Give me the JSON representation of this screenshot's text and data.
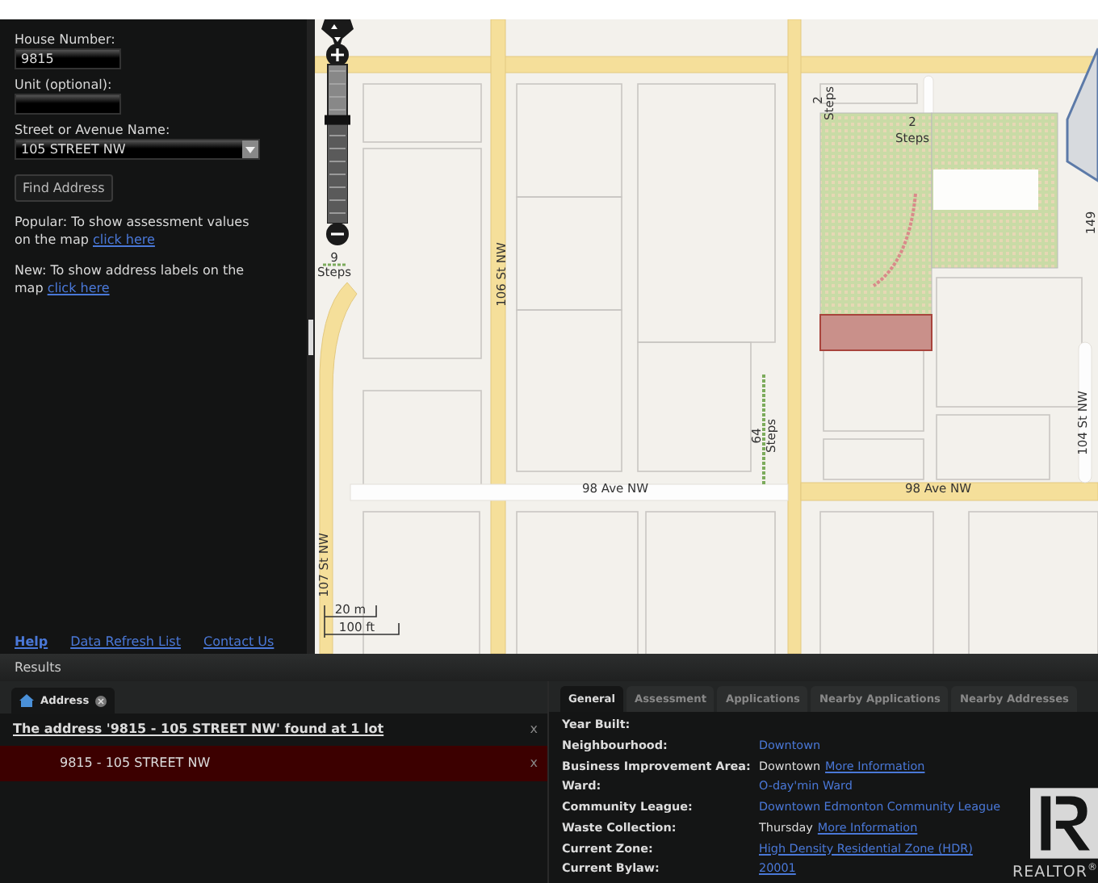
{
  "search_panel": {
    "fields": [
      {
        "label": "House Number:",
        "value": "9815",
        "kind": "text"
      },
      {
        "label": "Unit (optional):",
        "kind": "text"
      },
      {
        "label": "Street or Avenue Name:",
        "value": "105 STREET NW",
        "kind": "select"
      }
    ],
    "find_button": "Find Address",
    "notes": [
      {
        "text": "Popular: To show assessment values on the map",
        "link": "click here"
      },
      {
        "text": "New: To show address labels on the map",
        "link": "click here"
      }
    ],
    "footer_links": [
      {
        "text": "Help",
        "kind": "bold"
      },
      {
        "text": "Data Refresh List",
        "kind": "plain"
      },
      {
        "text": "Contact Us",
        "kind": "plain"
      }
    ]
  },
  "map": {
    "zoom_slider": {
      "level": 0.65
    },
    "labels": [
      {
        "text": "9"
      },
      {
        "text": "Steps"
      },
      {
        "text": "106 St NW"
      },
      {
        "text": "2"
      },
      {
        "text": "Steps"
      },
      {
        "text": "2"
      },
      {
        "text": "Steps"
      },
      {
        "text": "64"
      },
      {
        "text": "Steps"
      },
      {
        "text": "98 Ave NW"
      },
      {
        "text": "98 Ave NW"
      },
      {
        "text": "104 St NW"
      },
      {
        "text": "149"
      },
      {
        "text": "107 St NW"
      },
      {
        "text": "20 m"
      },
      {
        "text": "100 ft"
      }
    ]
  },
  "results": {
    "title": "Results",
    "tabs": [
      {
        "label": "Address",
        "selected": true
      }
    ],
    "heading": "The address '9815 - 105 STREET NW' found at 1 lot",
    "heading_close": "x",
    "items": [
      {
        "text": "9815 - 105 STREET NW",
        "close": "x",
        "selected": true
      }
    ]
  },
  "details": {
    "tabs": [
      {
        "label": "General",
        "selected": true
      },
      {
        "label": "Assessment",
        "selected": false
      },
      {
        "label": "Applications",
        "selected": false
      },
      {
        "label": "Nearby Applications",
        "selected": false
      },
      {
        "label": "Nearby Addresses",
        "selected": false
      }
    ],
    "rows": [
      {
        "label": "Year Built:",
        "parts": []
      },
      {
        "label": "Neighbourhood:",
        "parts": [
          {
            "text": "Downtown",
            "kind": "link"
          }
        ]
      },
      {
        "label": "Business Improvement Area:",
        "parts": [
          {
            "text": "Downtown",
            "kind": "text"
          },
          {
            "text": "More Information",
            "kind": "underlined-link"
          }
        ]
      },
      {
        "label": "Ward:",
        "parts": [
          {
            "text": "O-day'min Ward",
            "kind": "link"
          }
        ]
      },
      {
        "label": "Community League:",
        "parts": [
          {
            "text": "Downtown Edmonton Community League",
            "kind": "link"
          }
        ]
      },
      {
        "label": "Waste Collection:",
        "parts": [
          {
            "text": "Thursday",
            "kind": "text"
          },
          {
            "text": "More Information",
            "kind": "underlined-link"
          }
        ]
      },
      {
        "label": "Current Zone:",
        "parts": [
          {
            "text": "High Density Residential Zone (HDR)",
            "kind": "underlined-link"
          }
        ]
      },
      {
        "label": "Current Bylaw:",
        "parts": [
          {
            "text": "20001",
            "kind": "underlined-link"
          }
        ]
      }
    ]
  },
  "logo": {
    "wordmark": "REALTOR",
    "mark": "®"
  }
}
